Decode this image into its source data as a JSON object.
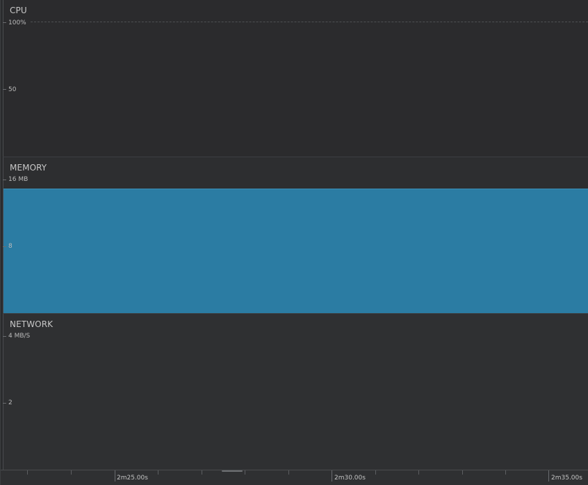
{
  "cpu": {
    "title": "CPU",
    "max_label": "100%",
    "mid_label": "50"
  },
  "memory": {
    "title": "MEMORY",
    "max_label": "16 MB",
    "mid_label": "8",
    "fill_color": "#2b7ca3",
    "used_fraction": 0.81
  },
  "network": {
    "title": "NETWORK",
    "max_label": "4 MB/S",
    "mid_label": "2"
  },
  "timeline": {
    "labels": [
      "2m25.00s",
      "2m30.00s",
      "2m35.00s"
    ]
  }
}
